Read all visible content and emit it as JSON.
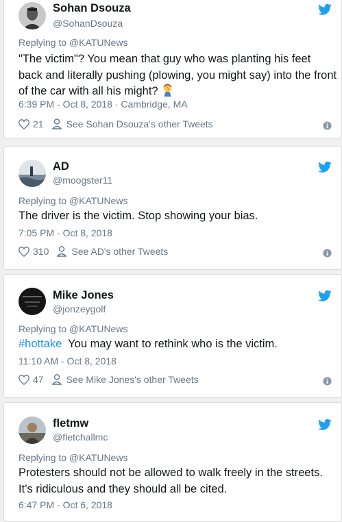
{
  "colors": {
    "background": "#f0f0f0",
    "card": "#ffffff",
    "text": "#14171a",
    "secondary": "#657786",
    "twitter_blue": "#1da1f2",
    "link": "#1b95e0"
  },
  "tweets": [
    {
      "name": "Sohan Dsouza",
      "handle": "@SohanDsouza",
      "replying": "Replying to @KATUNews",
      "text": "\"The victim\"? You mean that guy who was planting his feet back and literally pushing (plowing, you might say) into the front of the car with all his might? ",
      "emoji": "man-facepalming",
      "time": "6:39 PM - Oct 8, 2018 · Cambridge, MA",
      "likes": "21",
      "see_more": "See Sohan Dsouza's other Tweets"
    },
    {
      "name": "AD",
      "handle": "@moogster11",
      "replying": "Replying to @KATUNews",
      "text": "The driver is the victim. Stop showing your bias.",
      "time": "7:05 PM - Oct 8, 2018",
      "likes": "310",
      "see_more": "See AD's other Tweets"
    },
    {
      "name": "Mike Jones",
      "handle": "@jonzeygolf",
      "replying": "Replying to @KATUNews",
      "hashtag": "#hottake",
      "text": "  You may want to rethink who is the victim.",
      "time": "11:10 AM - Oct 8, 2018",
      "likes": "47",
      "see_more": "See Mike Jones's other Tweets"
    },
    {
      "name": "fletmw",
      "handle": "@fletchallmc",
      "replying": "Replying to @KATUNews",
      "text": "Protesters should not be allowed to walk freely in the streets. It’s ridiculous and they should all be cited.",
      "time": "6:47 PM - Oct 6, 2018"
    }
  ]
}
